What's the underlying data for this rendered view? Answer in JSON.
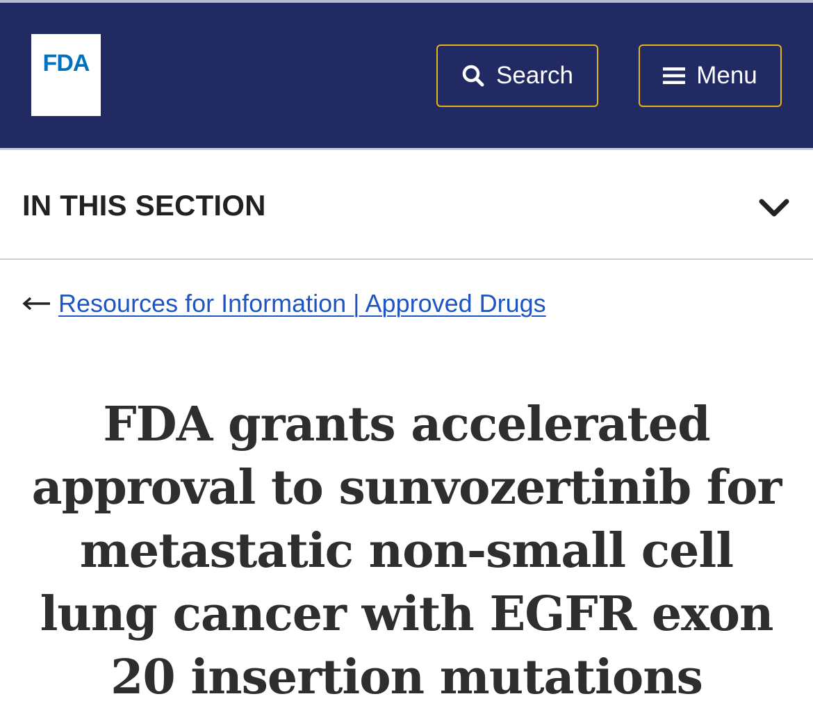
{
  "header": {
    "logo_text": "FDA",
    "search_label": "Search",
    "menu_label": "Menu",
    "colors": {
      "background": "#222a63",
      "button_border": "#e6b416",
      "logo_blue": "#0071bc"
    }
  },
  "section": {
    "title": "IN THIS SECTION",
    "toggle_icon": "chevron-down-icon"
  },
  "breadcrumb": {
    "link_text": "Resources for Information | Approved Drugs",
    "icon": "arrow-left-icon",
    "link_color": "#1f55c0"
  },
  "article": {
    "title": "FDA grants accelerated approval to sunvozertinib for metastatic non-small cell lung cancer with EGFR exon 20 insertion mutations"
  }
}
